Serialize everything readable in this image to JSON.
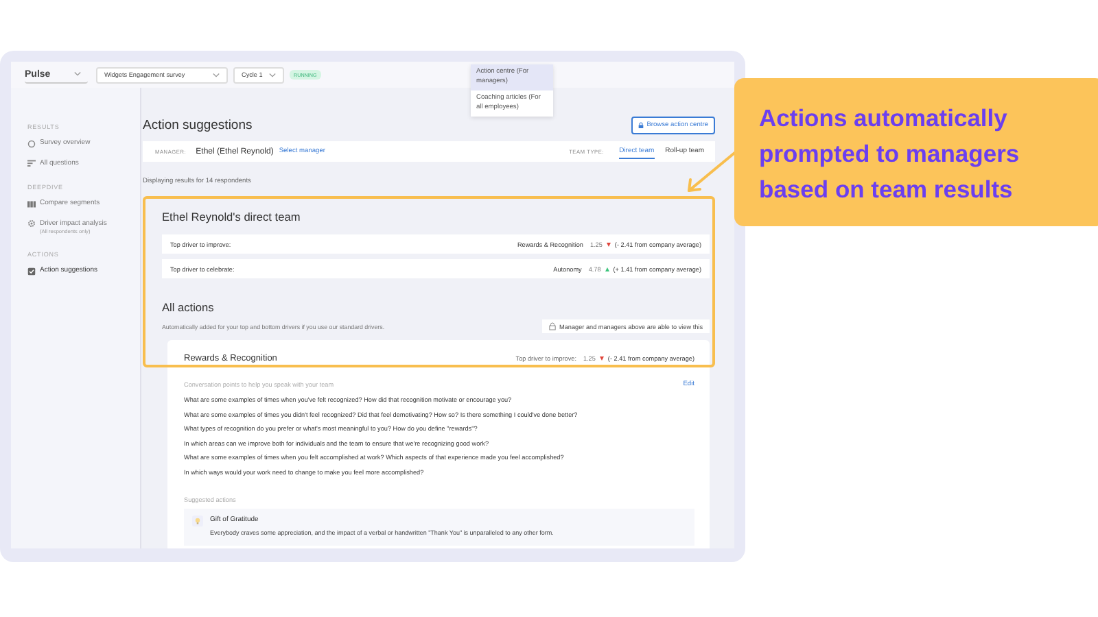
{
  "top_bar": {
    "app": "Pulse",
    "survey": "Widgets Engagement survey",
    "cycle": "Cycle 1",
    "status": "RUNNING"
  },
  "dropdown_menu": [
    {
      "label": "Action centre (For managers)",
      "selected": true
    },
    {
      "label": "Coaching articles (For all employees)",
      "selected": false
    }
  ],
  "sidebar": [
    {
      "heading": "RESULTS",
      "items": [
        {
          "label": "Survey overview",
          "selected": false
        },
        {
          "label": "All questions",
          "selected": false
        }
      ]
    },
    {
      "heading": "DEEPDIVE",
      "items": [
        {
          "label": "Compare segments",
          "selected": false
        },
        {
          "label": "Driver impact analysis",
          "note": "(All respondents only)",
          "selected": false
        }
      ]
    },
    {
      "heading": "ACTIONS",
      "items": [
        {
          "label": "Action suggestions",
          "selected": true
        }
      ]
    }
  ],
  "page": {
    "title": "Action suggestions",
    "browse_button": "Browse action centre",
    "manager_label": "MANAGER:",
    "manager": "Ethel (Ethel Reynold)",
    "select_manager": "Select manager",
    "team_type_label": "TEAM TYPE:",
    "team_tabs": [
      {
        "label": "Direct team",
        "selected": true
      },
      {
        "label": "Roll-up team",
        "selected": false
      }
    ],
    "respondents": "Displaying results for 14 respondents"
  },
  "team_summary": {
    "title": "Ethel Reynold's direct team",
    "drivers": [
      {
        "label": "Top driver to improve:",
        "driver": "Rewards & Recognition",
        "score": "1.25",
        "trend_up": false,
        "delta": "(- 2.41 from company average)"
      },
      {
        "label": "Top driver to celebrate:",
        "driver": "Autonomy",
        "score": "4.78",
        "trend_up": true,
        "delta": "(+ 1.41 from company average)"
      }
    ]
  },
  "all_actions": {
    "title": "All actions",
    "subtitle": "Automatically added for your top and bottom drivers if you use our standard drivers.",
    "visibility_note": "Manager and managers above are able to view this"
  },
  "driver_card": {
    "title": "Rewards & Recognition",
    "label": "Top driver to improve:",
    "score": "1.25",
    "trend_up": false,
    "delta": "(- 2.41 from company average)",
    "conversation_heading": "Conversation points to help you speak with your team",
    "edit": "Edit",
    "questions": [
      "What are some examples of times when you've felt recognized? How did that recognition motivate or encourage you?",
      "What are some examples of times you didn't feel recognized? Did that feel demotivating? How so? Is there something I could've done better?",
      "What types of recognition do you prefer or what's most meaningful to you? How do you define \"rewards\"?",
      "In which areas can we improve both for individuals and the team to ensure that we're recognizing good work?",
      "What are some examples of times when you felt accomplished at work? Which aspects of that experience made you feel accomplished?",
      "In which ways would your work need to change to make you feel more accomplished?"
    ],
    "suggested_heading": "Suggested actions",
    "suggestions": [
      {
        "title": "Gift of Gratitude",
        "text": "Everybody craves some appreciation, and the impact of a verbal or handwritten \"Thank You\" is unparalleled to any other form."
      }
    ]
  },
  "callout": {
    "text": "Actions automatically prompted to managers based on team results"
  }
}
